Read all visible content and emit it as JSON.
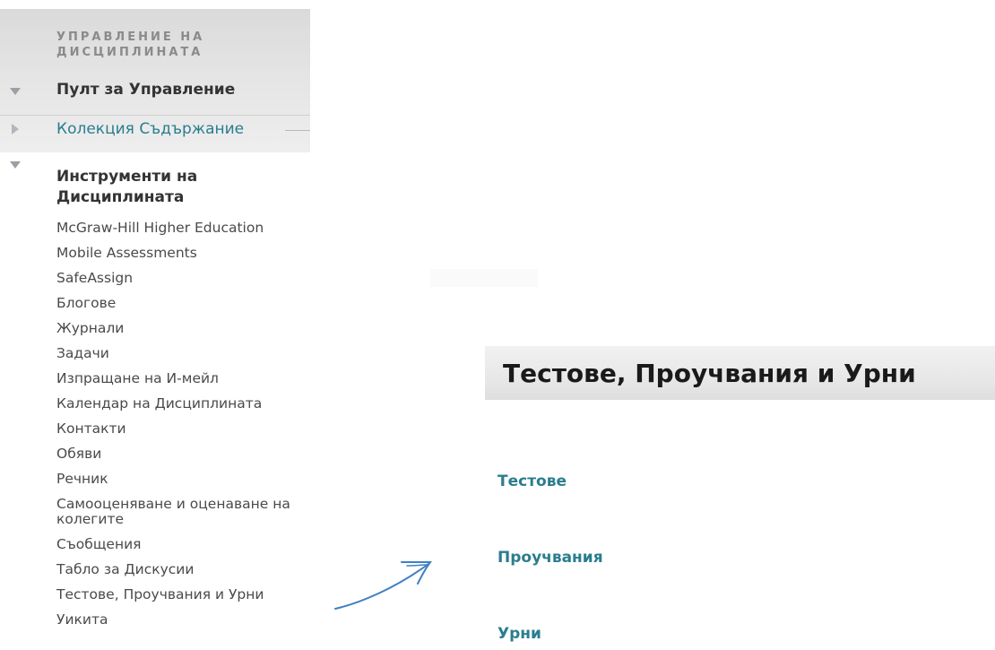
{
  "course_management": {
    "title": "УПРАВЛЕНИЕ НА ДИСЦИПЛИНАТА",
    "control_panel_label": "Пулт за Управление",
    "content_collection_label": "Колекция Съдържание",
    "course_tools_label": "Инструменти на Дисциплината",
    "course_tools": [
      "McGraw-Hill Higher Education",
      "Mobile Assessments",
      "SafeAssign",
      "Блогове",
      "Журнали",
      "Задачи",
      "Изпращане на И-мейл",
      "Календар на Дисциплината",
      "Контакти",
      "Обяви",
      "Речник",
      "Самооценяване и оценаване на колегите",
      "Съобщения",
      "Табло за Дискусии",
      "Тестове, Проучвания и Урни",
      "Уикита"
    ]
  },
  "content": {
    "page_title": "Тестове, Проучвания и Урни",
    "links": [
      "Тестове",
      "Проучвания",
      "Урни"
    ]
  },
  "colors": {
    "link": "#2a7d8e",
    "arrow": "#3f7fc4",
    "header_bg": "#e6e6e6"
  },
  "icons": {
    "control_panel": "triangle-down-icon",
    "content_collection": "triangle-right-icon",
    "course_tools": "triangle-down-icon",
    "pointer": "hand-drawn-arrow-icon"
  }
}
